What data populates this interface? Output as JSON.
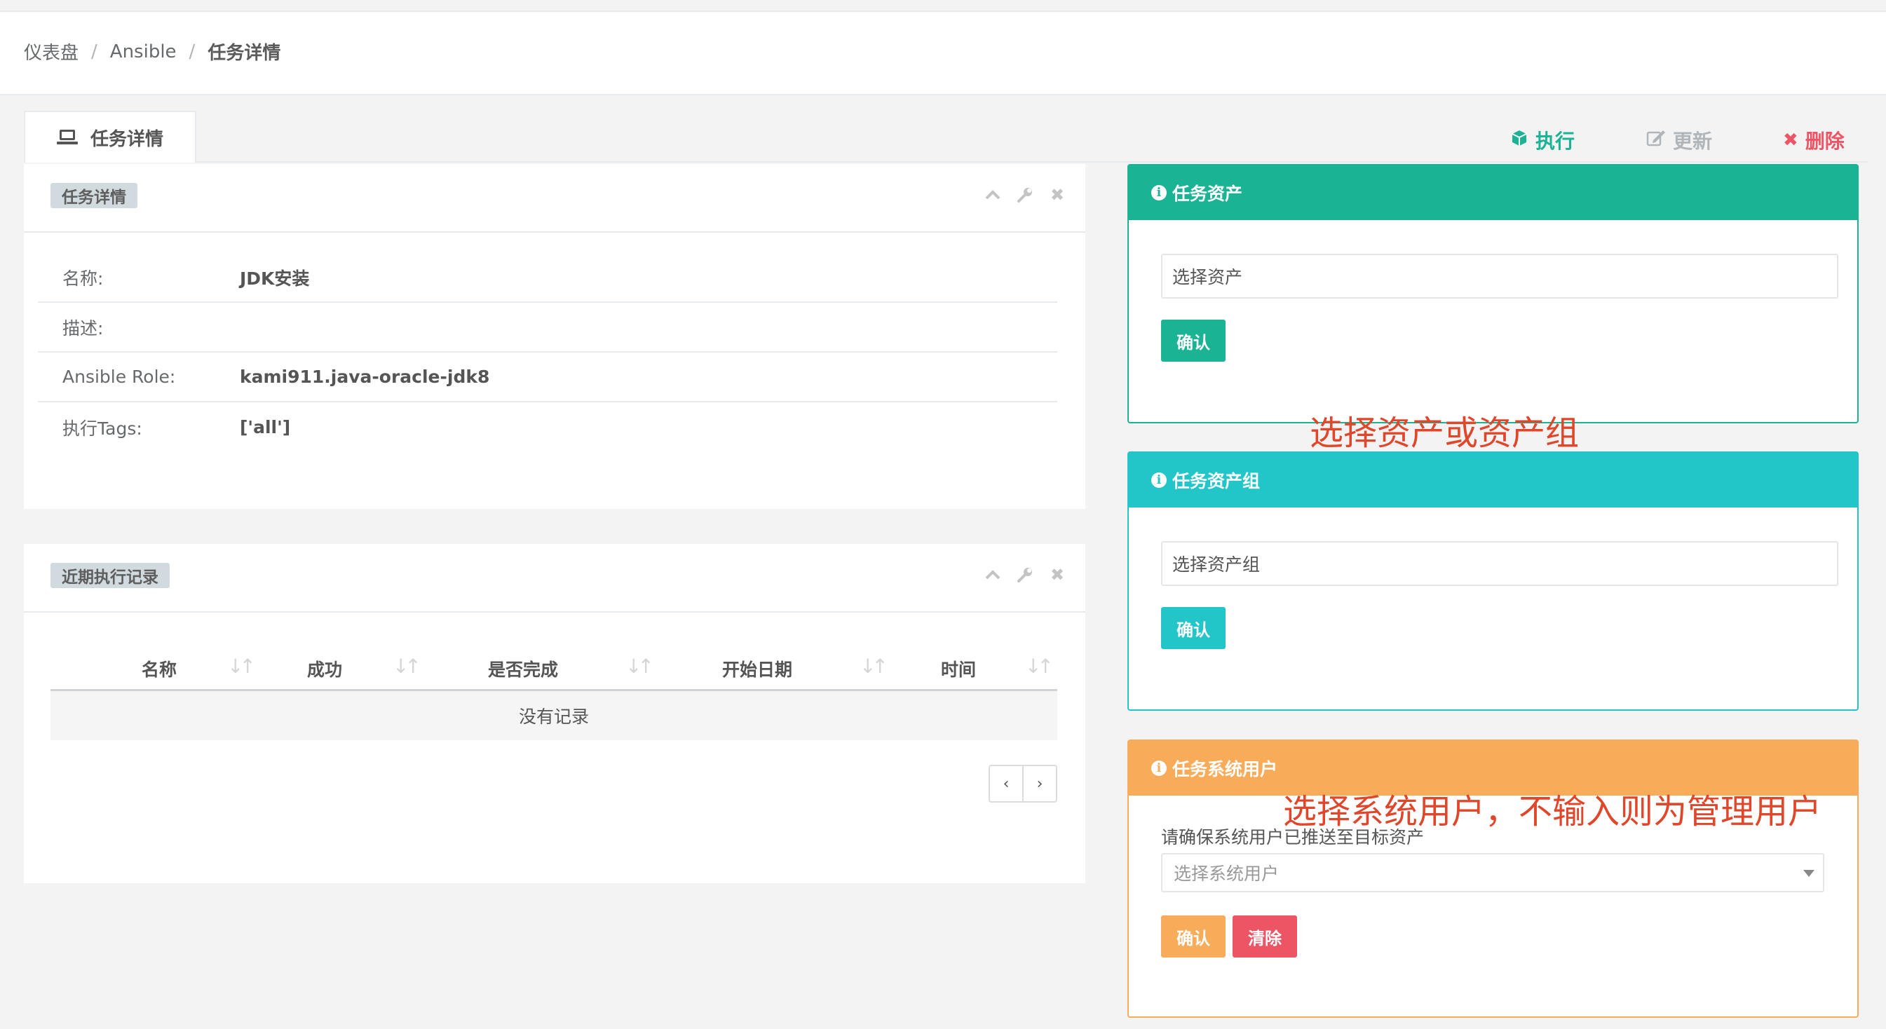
{
  "breadcrumb": [
    "仪表盘",
    "Ansible",
    "任务详情"
  ],
  "tab": {
    "label": "任务详情",
    "icon": "laptop-icon"
  },
  "actions": {
    "execute": {
      "label": "执行",
      "icon": "cube-icon",
      "color": "#1ab394"
    },
    "update": {
      "label": "更新",
      "icon": "edit-icon",
      "color": "#b0b5b9"
    },
    "delete": {
      "label": "删除",
      "icon": "times-icon",
      "color": "#ed5565"
    }
  },
  "details": {
    "title": "任务详情",
    "rows": [
      {
        "key": "名称:",
        "value": "JDK安装"
      },
      {
        "key": "描述:",
        "value": ""
      },
      {
        "key": "Ansible Role:",
        "value": "kami911.java-oracle-jdk8"
      },
      {
        "key": "执行Tags:",
        "value": "['all']"
      }
    ]
  },
  "records": {
    "title": "近期执行记录",
    "columns": [
      "名称",
      "成功",
      "是否完成",
      "开始日期",
      "时间"
    ],
    "empty_text": "没有记录",
    "pager": {
      "prev": "‹",
      "next": "›"
    }
  },
  "asset_panel": {
    "title": "任务资产",
    "placeholder": "选择资产",
    "confirm": "确认",
    "color": "#1ab394"
  },
  "asset_group_panel": {
    "title": "任务资产组",
    "placeholder": "选择资产组",
    "confirm": "确认",
    "color": "#23c6c8"
  },
  "system_user_panel": {
    "title": "任务系统用户",
    "note": "请确保系统用户已推送至目标资产",
    "placeholder": "选择系统用户",
    "confirm": "确认",
    "clear": "清除",
    "color": "#f8ac59",
    "clear_color": "#ed5565"
  },
  "annotations": {
    "asset": "选择资产或资产组",
    "system_user": "选择系统用户，不输入则为管理用户"
  }
}
